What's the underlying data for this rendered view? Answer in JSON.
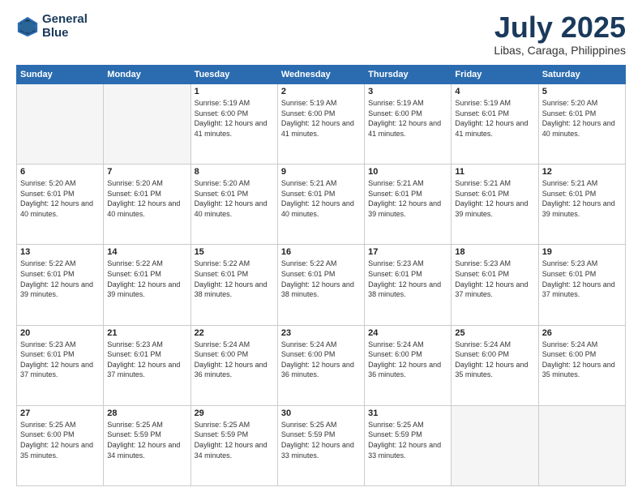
{
  "header": {
    "logo_line1": "General",
    "logo_line2": "Blue",
    "month": "July 2025",
    "location": "Libas, Caraga, Philippines"
  },
  "days_of_week": [
    "Sunday",
    "Monday",
    "Tuesday",
    "Wednesday",
    "Thursday",
    "Friday",
    "Saturday"
  ],
  "weeks": [
    [
      {
        "day": "",
        "info": ""
      },
      {
        "day": "",
        "info": ""
      },
      {
        "day": "1",
        "info": "Sunrise: 5:19 AM\nSunset: 6:00 PM\nDaylight: 12 hours and 41 minutes."
      },
      {
        "day": "2",
        "info": "Sunrise: 5:19 AM\nSunset: 6:00 PM\nDaylight: 12 hours and 41 minutes."
      },
      {
        "day": "3",
        "info": "Sunrise: 5:19 AM\nSunset: 6:00 PM\nDaylight: 12 hours and 41 minutes."
      },
      {
        "day": "4",
        "info": "Sunrise: 5:19 AM\nSunset: 6:01 PM\nDaylight: 12 hours and 41 minutes."
      },
      {
        "day": "5",
        "info": "Sunrise: 5:20 AM\nSunset: 6:01 PM\nDaylight: 12 hours and 40 minutes."
      }
    ],
    [
      {
        "day": "6",
        "info": "Sunrise: 5:20 AM\nSunset: 6:01 PM\nDaylight: 12 hours and 40 minutes."
      },
      {
        "day": "7",
        "info": "Sunrise: 5:20 AM\nSunset: 6:01 PM\nDaylight: 12 hours and 40 minutes."
      },
      {
        "day": "8",
        "info": "Sunrise: 5:20 AM\nSunset: 6:01 PM\nDaylight: 12 hours and 40 minutes."
      },
      {
        "day": "9",
        "info": "Sunrise: 5:21 AM\nSunset: 6:01 PM\nDaylight: 12 hours and 40 minutes."
      },
      {
        "day": "10",
        "info": "Sunrise: 5:21 AM\nSunset: 6:01 PM\nDaylight: 12 hours and 39 minutes."
      },
      {
        "day": "11",
        "info": "Sunrise: 5:21 AM\nSunset: 6:01 PM\nDaylight: 12 hours and 39 minutes."
      },
      {
        "day": "12",
        "info": "Sunrise: 5:21 AM\nSunset: 6:01 PM\nDaylight: 12 hours and 39 minutes."
      }
    ],
    [
      {
        "day": "13",
        "info": "Sunrise: 5:22 AM\nSunset: 6:01 PM\nDaylight: 12 hours and 39 minutes."
      },
      {
        "day": "14",
        "info": "Sunrise: 5:22 AM\nSunset: 6:01 PM\nDaylight: 12 hours and 39 minutes."
      },
      {
        "day": "15",
        "info": "Sunrise: 5:22 AM\nSunset: 6:01 PM\nDaylight: 12 hours and 38 minutes."
      },
      {
        "day": "16",
        "info": "Sunrise: 5:22 AM\nSunset: 6:01 PM\nDaylight: 12 hours and 38 minutes."
      },
      {
        "day": "17",
        "info": "Sunrise: 5:23 AM\nSunset: 6:01 PM\nDaylight: 12 hours and 38 minutes."
      },
      {
        "day": "18",
        "info": "Sunrise: 5:23 AM\nSunset: 6:01 PM\nDaylight: 12 hours and 37 minutes."
      },
      {
        "day": "19",
        "info": "Sunrise: 5:23 AM\nSunset: 6:01 PM\nDaylight: 12 hours and 37 minutes."
      }
    ],
    [
      {
        "day": "20",
        "info": "Sunrise: 5:23 AM\nSunset: 6:01 PM\nDaylight: 12 hours and 37 minutes."
      },
      {
        "day": "21",
        "info": "Sunrise: 5:23 AM\nSunset: 6:01 PM\nDaylight: 12 hours and 37 minutes."
      },
      {
        "day": "22",
        "info": "Sunrise: 5:24 AM\nSunset: 6:00 PM\nDaylight: 12 hours and 36 minutes."
      },
      {
        "day": "23",
        "info": "Sunrise: 5:24 AM\nSunset: 6:00 PM\nDaylight: 12 hours and 36 minutes."
      },
      {
        "day": "24",
        "info": "Sunrise: 5:24 AM\nSunset: 6:00 PM\nDaylight: 12 hours and 36 minutes."
      },
      {
        "day": "25",
        "info": "Sunrise: 5:24 AM\nSunset: 6:00 PM\nDaylight: 12 hours and 35 minutes."
      },
      {
        "day": "26",
        "info": "Sunrise: 5:24 AM\nSunset: 6:00 PM\nDaylight: 12 hours and 35 minutes."
      }
    ],
    [
      {
        "day": "27",
        "info": "Sunrise: 5:25 AM\nSunset: 6:00 PM\nDaylight: 12 hours and 35 minutes."
      },
      {
        "day": "28",
        "info": "Sunrise: 5:25 AM\nSunset: 5:59 PM\nDaylight: 12 hours and 34 minutes."
      },
      {
        "day": "29",
        "info": "Sunrise: 5:25 AM\nSunset: 5:59 PM\nDaylight: 12 hours and 34 minutes."
      },
      {
        "day": "30",
        "info": "Sunrise: 5:25 AM\nSunset: 5:59 PM\nDaylight: 12 hours and 33 minutes."
      },
      {
        "day": "31",
        "info": "Sunrise: 5:25 AM\nSunset: 5:59 PM\nDaylight: 12 hours and 33 minutes."
      },
      {
        "day": "",
        "info": ""
      },
      {
        "day": "",
        "info": ""
      }
    ]
  ]
}
